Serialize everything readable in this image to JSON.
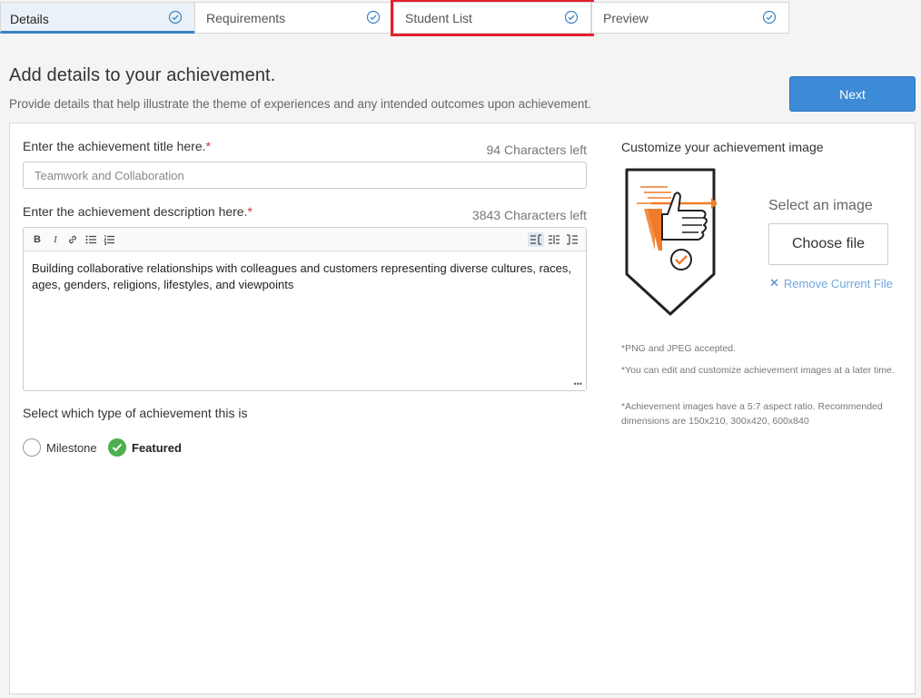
{
  "tabs": [
    {
      "label": "Details",
      "state": "active"
    },
    {
      "label": "Requirements",
      "state": "default"
    },
    {
      "label": "Student List",
      "state": "highlighted"
    },
    {
      "label": "Preview",
      "state": "default"
    }
  ],
  "header": {
    "title": "Add details to your achievement.",
    "subtitle": "Provide details that help illustrate the theme of experiences and any intended outcomes upon achievement.",
    "next_label": "Next"
  },
  "form": {
    "title_label": "Enter the achievement title here.",
    "required_mark": "*",
    "title_chars_left": "94 Characters left",
    "title_value": "Teamwork and Collaboration",
    "description_label": "Enter the achievement description here.",
    "description_chars_left": "3843 Characters left",
    "description_value": "Building collaborative relationships with colleagues and customers representing diverse cultures, races, ages, genders, religions, lifestyles, and viewpoints",
    "toolbar": {
      "bold": "B",
      "italic": "I",
      "link_icon": "link-icon",
      "bullet_list_icon": "bullet-list-icon",
      "numbered_list_icon": "numbered-list-icon",
      "view_icons": [
        "view-split-left-icon",
        "view-split-center-icon",
        "view-split-right-icon"
      ]
    },
    "type_label": "Select which type of achievement this is",
    "type_options": [
      {
        "label": "Milestone",
        "selected": false
      },
      {
        "label": "Featured",
        "selected": true
      }
    ]
  },
  "image_panel": {
    "heading": "Customize your achievement image",
    "select_label": "Select an image",
    "choose_file_label": "Choose file",
    "remove_label": "Remove Current File",
    "notes": [
      "*PNG and JPEG accepted.",
      "*You can edit and customize achievement images at a later time.",
      "*Achievement images have a 5:7 aspect ratio. Recommended dimensions are 150x210, 300x420, 600x840"
    ]
  },
  "colors": {
    "accent": "#3d8ad6",
    "required": "#d32f2f",
    "success": "#4caf50",
    "highlight_border": "#e5202e",
    "badge_orange": "#f07c2a"
  }
}
